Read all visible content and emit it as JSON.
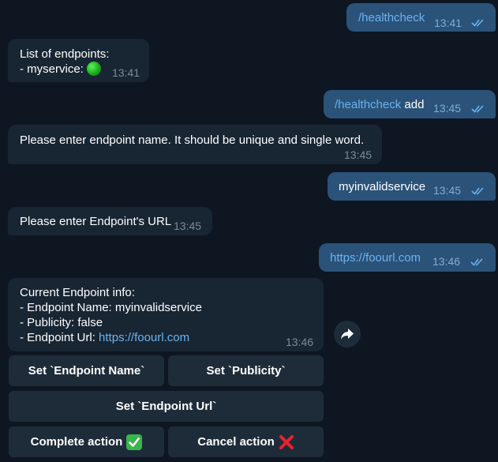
{
  "messages": [
    {
      "text_cmd": "/healthcheck",
      "time": "13:41"
    },
    {
      "line1": "List of endpoints:",
      "line2": "- myservice:",
      "time": "13:41"
    },
    {
      "text_cmd": "/healthcheck",
      "text_rest": "add",
      "time": "13:45"
    },
    {
      "text": "Please enter endpoint name. It should be unique and single word.",
      "time": "13:45"
    },
    {
      "text": "myinvalidservice",
      "time": "13:45"
    },
    {
      "text": "Please enter Endpoint's URL",
      "time": "13:45"
    },
    {
      "text_link": "https://foourl.com",
      "time": "13:46"
    },
    {
      "line1": "Current Endpoint info:",
      "line2": "- Endpoint Name: myinvalidservice",
      "line3": "- Publicity: false",
      "line4_prefix": "- Endpoint Url: ",
      "line4_link": "https://foourl.com",
      "time": "13:46"
    }
  ],
  "keyboard": {
    "set_name": "Set `Endpoint Name`",
    "set_publicity": "Set `Publicity`",
    "set_url": "Set `Endpoint Url`",
    "complete": "Complete action",
    "cancel": "Cancel action"
  },
  "icons": {
    "read_receipt": "double-check-icon",
    "status": "green-circle-emoji",
    "complete": "check-mark-emoji",
    "cancel": "cross-mark-emoji",
    "share": "share-arrow-icon"
  },
  "colors": {
    "background": "#0e1621",
    "outgoing_bubble": "#2b5278",
    "incoming_bubble": "#182533",
    "link": "#6ab3f3",
    "keyboard_button": "#1e2c3a"
  }
}
